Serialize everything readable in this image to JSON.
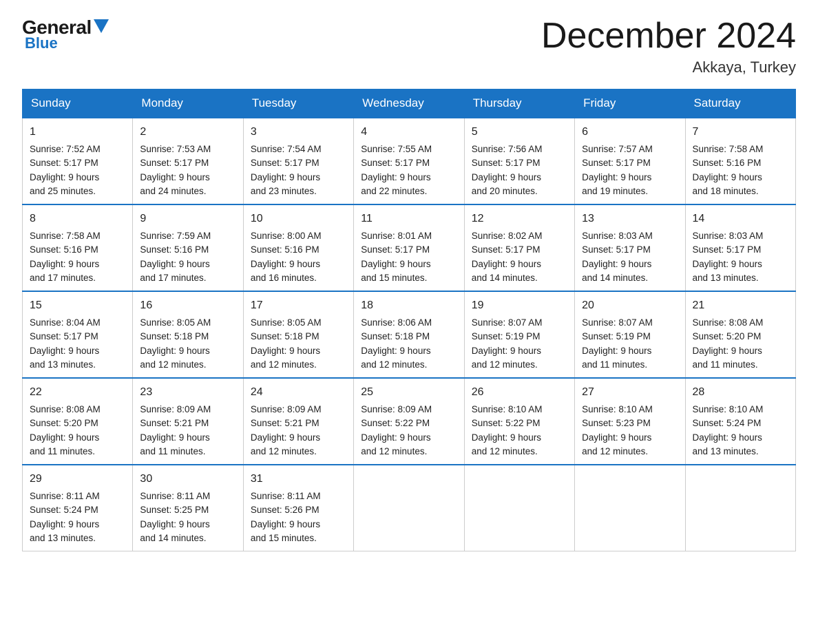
{
  "logo": {
    "general": "General",
    "blue": "Blue",
    "triangle": "▲"
  },
  "title": "December 2024",
  "location": "Akkaya, Turkey",
  "days": [
    "Sunday",
    "Monday",
    "Tuesday",
    "Wednesday",
    "Thursday",
    "Friday",
    "Saturday"
  ],
  "weeks": [
    [
      {
        "num": "1",
        "sunrise": "7:52 AM",
        "sunset": "5:17 PM",
        "daylight": "9 hours and 25 minutes."
      },
      {
        "num": "2",
        "sunrise": "7:53 AM",
        "sunset": "5:17 PM",
        "daylight": "9 hours and 24 minutes."
      },
      {
        "num": "3",
        "sunrise": "7:54 AM",
        "sunset": "5:17 PM",
        "daylight": "9 hours and 23 minutes."
      },
      {
        "num": "4",
        "sunrise": "7:55 AM",
        "sunset": "5:17 PM",
        "daylight": "9 hours and 22 minutes."
      },
      {
        "num": "5",
        "sunrise": "7:56 AM",
        "sunset": "5:17 PM",
        "daylight": "9 hours and 20 minutes."
      },
      {
        "num": "6",
        "sunrise": "7:57 AM",
        "sunset": "5:17 PM",
        "daylight": "9 hours and 19 minutes."
      },
      {
        "num": "7",
        "sunrise": "7:58 AM",
        "sunset": "5:16 PM",
        "daylight": "9 hours and 18 minutes."
      }
    ],
    [
      {
        "num": "8",
        "sunrise": "7:58 AM",
        "sunset": "5:16 PM",
        "daylight": "9 hours and 17 minutes."
      },
      {
        "num": "9",
        "sunrise": "7:59 AM",
        "sunset": "5:16 PM",
        "daylight": "9 hours and 17 minutes."
      },
      {
        "num": "10",
        "sunrise": "8:00 AM",
        "sunset": "5:16 PM",
        "daylight": "9 hours and 16 minutes."
      },
      {
        "num": "11",
        "sunrise": "8:01 AM",
        "sunset": "5:17 PM",
        "daylight": "9 hours and 15 minutes."
      },
      {
        "num": "12",
        "sunrise": "8:02 AM",
        "sunset": "5:17 PM",
        "daylight": "9 hours and 14 minutes."
      },
      {
        "num": "13",
        "sunrise": "8:03 AM",
        "sunset": "5:17 PM",
        "daylight": "9 hours and 14 minutes."
      },
      {
        "num": "14",
        "sunrise": "8:03 AM",
        "sunset": "5:17 PM",
        "daylight": "9 hours and 13 minutes."
      }
    ],
    [
      {
        "num": "15",
        "sunrise": "8:04 AM",
        "sunset": "5:17 PM",
        "daylight": "9 hours and 13 minutes."
      },
      {
        "num": "16",
        "sunrise": "8:05 AM",
        "sunset": "5:18 PM",
        "daylight": "9 hours and 12 minutes."
      },
      {
        "num": "17",
        "sunrise": "8:05 AM",
        "sunset": "5:18 PM",
        "daylight": "9 hours and 12 minutes."
      },
      {
        "num": "18",
        "sunrise": "8:06 AM",
        "sunset": "5:18 PM",
        "daylight": "9 hours and 12 minutes."
      },
      {
        "num": "19",
        "sunrise": "8:07 AM",
        "sunset": "5:19 PM",
        "daylight": "9 hours and 12 minutes."
      },
      {
        "num": "20",
        "sunrise": "8:07 AM",
        "sunset": "5:19 PM",
        "daylight": "9 hours and 11 minutes."
      },
      {
        "num": "21",
        "sunrise": "8:08 AM",
        "sunset": "5:20 PM",
        "daylight": "9 hours and 11 minutes."
      }
    ],
    [
      {
        "num": "22",
        "sunrise": "8:08 AM",
        "sunset": "5:20 PM",
        "daylight": "9 hours and 11 minutes."
      },
      {
        "num": "23",
        "sunrise": "8:09 AM",
        "sunset": "5:21 PM",
        "daylight": "9 hours and 11 minutes."
      },
      {
        "num": "24",
        "sunrise": "8:09 AM",
        "sunset": "5:21 PM",
        "daylight": "9 hours and 12 minutes."
      },
      {
        "num": "25",
        "sunrise": "8:09 AM",
        "sunset": "5:22 PM",
        "daylight": "9 hours and 12 minutes."
      },
      {
        "num": "26",
        "sunrise": "8:10 AM",
        "sunset": "5:22 PM",
        "daylight": "9 hours and 12 minutes."
      },
      {
        "num": "27",
        "sunrise": "8:10 AM",
        "sunset": "5:23 PM",
        "daylight": "9 hours and 12 minutes."
      },
      {
        "num": "28",
        "sunrise": "8:10 AM",
        "sunset": "5:24 PM",
        "daylight": "9 hours and 13 minutes."
      }
    ],
    [
      {
        "num": "29",
        "sunrise": "8:11 AM",
        "sunset": "5:24 PM",
        "daylight": "9 hours and 13 minutes."
      },
      {
        "num": "30",
        "sunrise": "8:11 AM",
        "sunset": "5:25 PM",
        "daylight": "9 hours and 14 minutes."
      },
      {
        "num": "31",
        "sunrise": "8:11 AM",
        "sunset": "5:26 PM",
        "daylight": "9 hours and 15 minutes."
      },
      null,
      null,
      null,
      null
    ]
  ]
}
